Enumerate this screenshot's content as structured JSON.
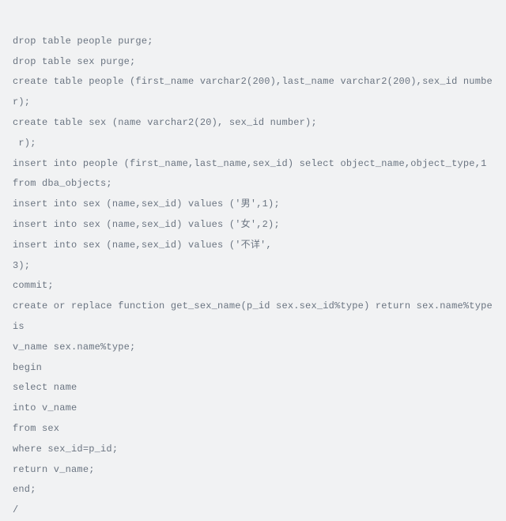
{
  "code": {
    "lines": [
      "drop table people purge;",
      "drop table sex purge;",
      "create table people (first_name varchar2(200),last_name varchar2(200),sex_id number);",
      "create table sex (name varchar2(20), sex_id number);",
      " r);",
      "insert into people (first_name,last_name,sex_id) select object_name,object_type,1 from dba_objects;",
      "insert into sex (name,sex_id) values ('男',1);",
      "insert into sex (name,sex_id) values ('女',2);",
      "insert into sex (name,sex_id) values ('不详',",
      "3);",
      "commit;",
      "create or replace function get_sex_name(p_id sex.sex_id%type) return sex.name%type is",
      "v_name sex.name%type;",
      "begin",
      "select name",
      "into v_name",
      "from sex",
      "where sex_id=p_id;",
      "return v_name;",
      "end;",
      "/"
    ]
  }
}
